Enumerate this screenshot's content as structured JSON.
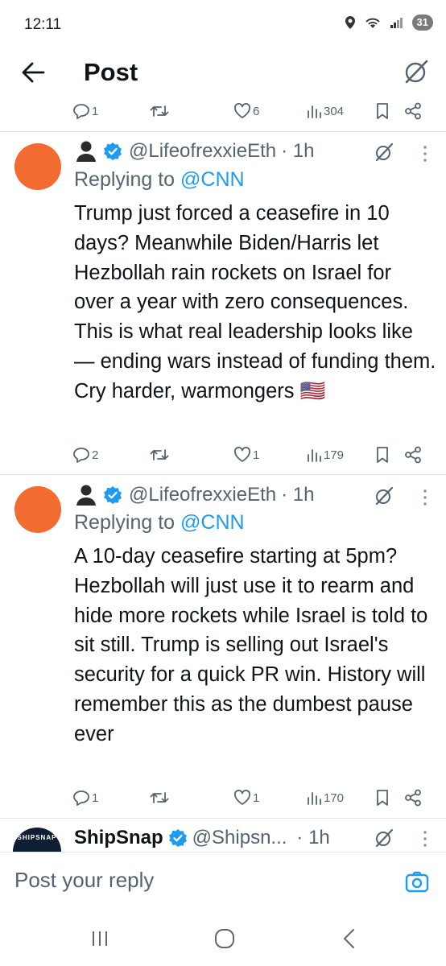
{
  "status_bar": {
    "time": "12:11",
    "battery": "31"
  },
  "header": {
    "title": "Post"
  },
  "top_actions": {
    "replies": "1",
    "reposts": "",
    "likes": "6",
    "views": "304"
  },
  "tweets": [
    {
      "handle": "@LifeofrexxieEth",
      "time": "· 1h",
      "replying_label": "Replying to",
      "replying_to": "@CNN",
      "text": "Trump just forced a ceasefire in 10 days? Meanwhile Biden/Harris let Hezbollah rain rockets on Israel for over a year with zero consequences. This is what real leadership looks like — ending wars instead of funding them. Cry harder, warmongers 🇺🇸",
      "replies": "2",
      "likes": "1",
      "views": "179"
    },
    {
      "handle": "@LifeofrexxieEth",
      "time": "· 1h",
      "replying_label": "Replying to",
      "replying_to": "@CNN",
      "text": "A 10-day ceasefire starting at 5pm? Hezbollah will just use it to rearm and hide more rockets while Israel is told to sit still. Trump is selling out Israel's security for a quick PR win. History will remember this as the dumbest pause ever",
      "replies": "1",
      "likes": "1",
      "views": "170"
    },
    {
      "name": "ShipSnap",
      "handle": "@Shipsn...",
      "time": "· 1h",
      "avatar_text": "SHIPSNAP"
    }
  ],
  "composer": {
    "placeholder": "Post your reply"
  },
  "colors": {
    "accent": "#1d9bf0",
    "muted": "#536471",
    "avatar": "#f26b30"
  }
}
